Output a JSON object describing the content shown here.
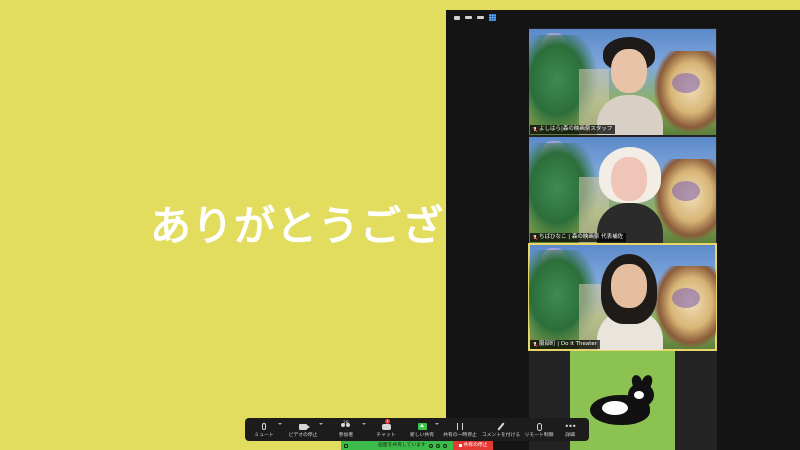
{
  "slide": {
    "text": "ありがとうござい"
  },
  "gallery": {
    "participants": [
      {
        "name": "よしはら|森の映画祭スタッフ",
        "muted": true,
        "active": false
      },
      {
        "name": "ちばひなこ | 森の映画祭 代表補佐",
        "muted": true,
        "active": false
      },
      {
        "name": "服部町 | Do it Theater",
        "muted": true,
        "active": true
      }
    ]
  },
  "toolbar": {
    "mute_label": "ミュート",
    "video_label": "ビデオの停止",
    "participants_label": "参加者",
    "participants_count": "28",
    "chat_label": "チャット",
    "chat_badge": "1",
    "new_share_label": "新しい共有",
    "pause_share_label": "共有の一時停止",
    "annotate_label": "コメントを付ける",
    "remote_control_label": "リモート制御",
    "more_label": "詳細"
  },
  "share_bar": {
    "status": "画面を共有しています",
    "stop_label": "共有の停止"
  },
  "colors": {
    "slide_bg": "#e2dd5e",
    "share_green": "#3dbb4a",
    "stop_red": "#e33a33",
    "active_border": "#e9d66b"
  }
}
